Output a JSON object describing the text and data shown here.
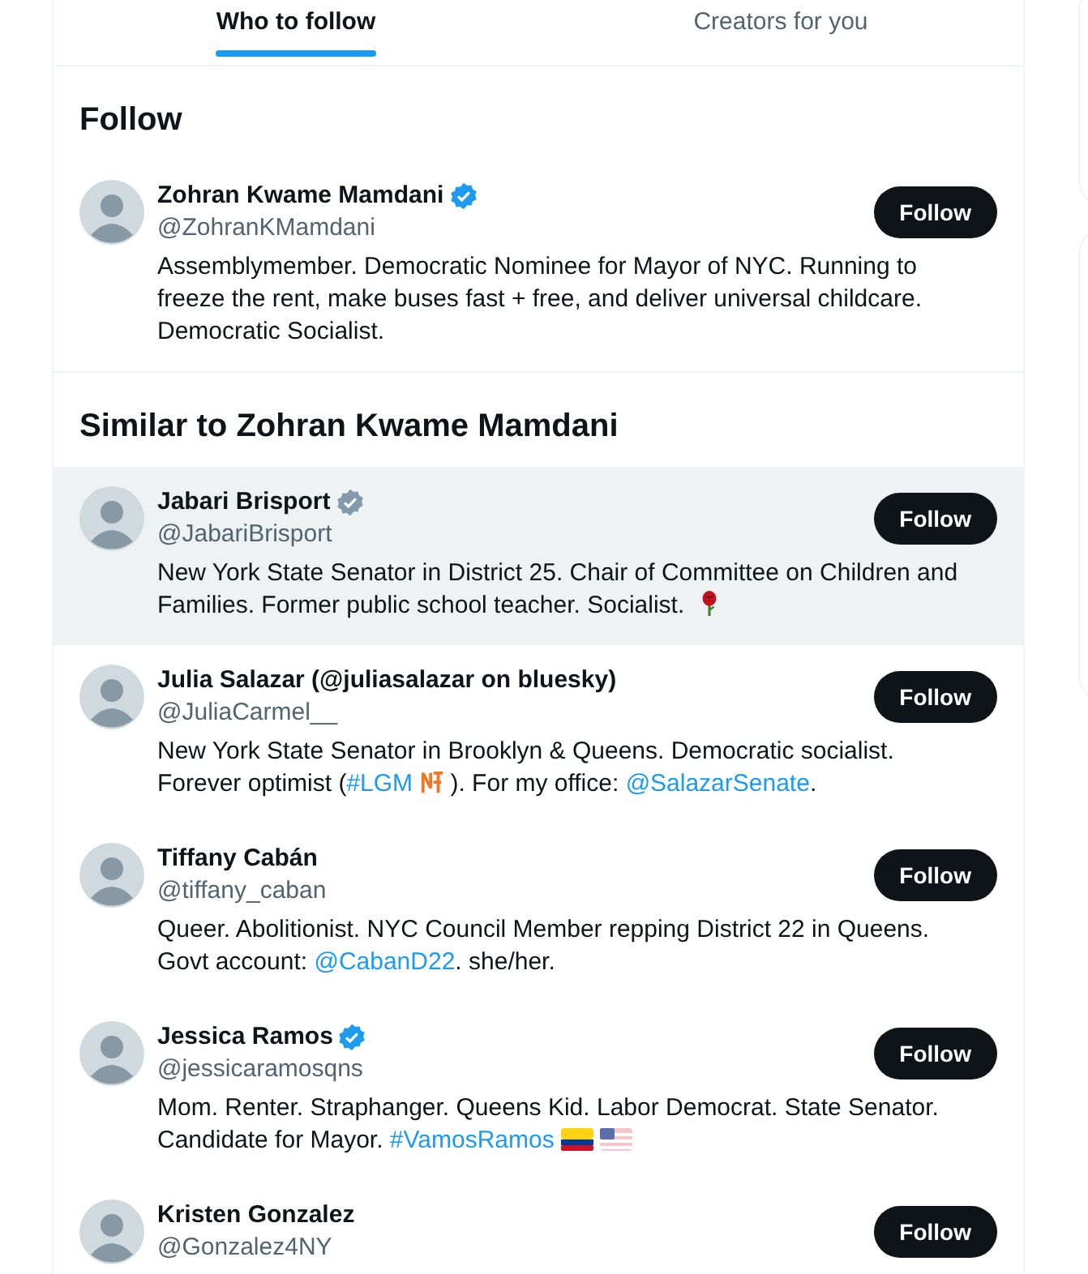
{
  "tabs": [
    {
      "label": "Who to follow",
      "selected": true
    },
    {
      "label": "Creators for you",
      "selected": false
    }
  ],
  "sections": [
    {
      "title": "Follow",
      "users": [
        {
          "name": "Zohran Kwame Mamdani",
          "badge": {
            "color": "#1d9bf0"
          },
          "handle": "@ZohranKMamdani",
          "button": "Follow",
          "hovered": false,
          "bio": [
            {
              "kind": "text",
              "text": "Assemblymember. Democratic Nominee for Mayor of NYC. Running to freeze the rent, make buses fast + free, and deliver universal childcare. Democratic Socialist."
            }
          ]
        }
      ]
    },
    {
      "title": "Similar to Zohran Kwame Mamdani",
      "users": [
        {
          "name": "Jabari Brisport",
          "badge": {
            "color": "#829aab"
          },
          "handle": "@JabariBrisport",
          "button": "Follow",
          "hovered": true,
          "bio": [
            {
              "kind": "text",
              "text": "New York State Senator in District 25. Chair of Committee on Children and Families. Former public school teacher. Socialist. "
            },
            {
              "kind": "rose"
            }
          ]
        },
        {
          "name": "Julia Salazar (@juliasalazar on bluesky)",
          "handle": "@JuliaCarmel__",
          "button": "Follow",
          "hovered": false,
          "bio": [
            {
              "kind": "text",
              "text": "New York State Senator in Brooklyn & Queens. Democratic socialist. Forever optimist ("
            },
            {
              "kind": "link",
              "text": "#LGM"
            },
            {
              "kind": "monogram"
            },
            {
              "kind": "text",
              "text": " ). For my office: "
            },
            {
              "kind": "link",
              "text": "@SalazarSenate"
            },
            {
              "kind": "text",
              "text": "."
            }
          ]
        },
        {
          "name": "Tiffany Cabán",
          "handle": "@tiffany_caban",
          "button": "Follow",
          "hovered": false,
          "bio": [
            {
              "kind": "text",
              "text": "Queer. Abolitionist. NYC Council Member repping District 22 in Queens. Govt account: "
            },
            {
              "kind": "link",
              "text": "@CabanD22"
            },
            {
              "kind": "text",
              "text": ". she/her."
            }
          ]
        },
        {
          "name": "Jessica Ramos",
          "badge": {
            "color": "#1d9bf0"
          },
          "handle": "@jessicaramosqns",
          "button": "Follow",
          "hovered": false,
          "bio": [
            {
              "kind": "text",
              "text": "Mom. Renter. Straphanger. Queens Kid. Labor Democrat. State Senator. Candidate for Mayor. "
            },
            {
              "kind": "link",
              "text": "#VamosRamos"
            },
            {
              "kind": "flag-tricolor"
            },
            {
              "kind": "flag-stripes"
            }
          ]
        },
        {
          "name": "Kristen Gonzalez",
          "handle": "@Gonzalez4NY",
          "button": "Follow",
          "hovered": false
        }
      ]
    }
  ]
}
